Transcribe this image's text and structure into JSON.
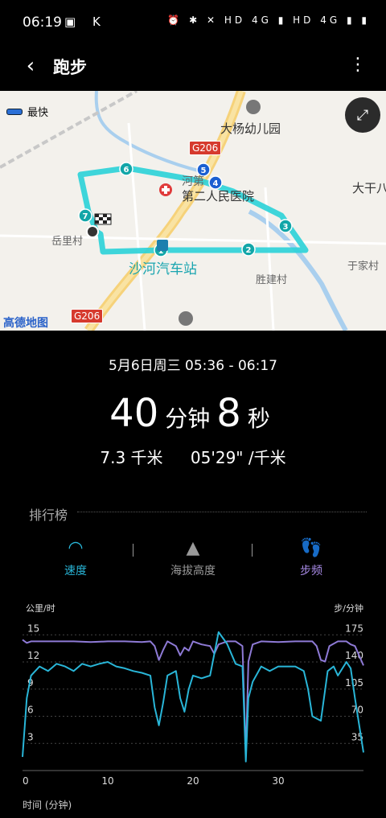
{
  "status_bar": {
    "time": "06:19",
    "left_icons": "▣ K",
    "right_icons": "⏰ ✱ ✕ HD 4G ▮ HD 4G ▮ ▮"
  },
  "app_bar": {
    "title": "跑步"
  },
  "map": {
    "legend_label": "最快",
    "labels": {
      "kindergarten": "大杨幼儿园",
      "hospital": "第二人民医院",
      "hospital_prefix": "河第",
      "dagan": "大干八",
      "yueli": "岳里村",
      "station": "沙河汽车站",
      "shengjian": "胜建村",
      "yujia": "于家村",
      "road_top": "G206",
      "road_bottom": "G206",
      "provider": "高德地图"
    },
    "markers": [
      "1",
      "2",
      "3",
      "4",
      "5",
      "6",
      "7"
    ]
  },
  "session": {
    "date_range": "5月6日周三 05:36 - 06:17",
    "minutes": "40",
    "minutes_unit": "分钟",
    "seconds": "8",
    "seconds_unit": "秒",
    "distance": "7.3 千米",
    "pace": "05'29\" /千米"
  },
  "section_title": "排行榜",
  "tabs": {
    "speed": "速度",
    "altitude": "海拔高度",
    "cadence": "步频"
  },
  "colors": {
    "speed": "#29b6d8",
    "cadence": "#8e7ad6",
    "altitude_inactive": "#999999"
  },
  "chart_data": {
    "type": "line",
    "x_label": "时间 (分钟)",
    "y_left_label": "公里/时",
    "y_right_label": "步/分钟",
    "x_ticks": [
      "0",
      "10",
      "20",
      "30"
    ],
    "y_left_ticks": [
      "15",
      "12",
      "9",
      "6",
      "3"
    ],
    "y_right_ticks": [
      "175",
      "140",
      "105",
      "70",
      "35"
    ],
    "xlim": [
      0,
      40
    ],
    "ylim_left": [
      0,
      16
    ],
    "ylim_right": [
      0,
      186
    ],
    "series": [
      {
        "name": "速度",
        "axis": "left",
        "x": [
          0,
          0.5,
          1,
          2,
          3,
          4,
          5,
          6,
          7,
          8,
          9,
          10,
          11,
          12,
          13,
          14,
          15,
          15.5,
          16,
          16.5,
          17,
          18,
          18.5,
          19,
          19.5,
          20,
          21,
          22,
          23,
          24,
          25,
          25.8,
          26.2,
          26.5,
          27,
          28,
          29,
          30,
          31,
          32,
          33,
          33.5,
          34,
          35,
          35.8,
          36.5,
          37,
          38,
          38.5,
          39,
          40
        ],
        "y": [
          1.5,
          8,
          10.5,
          11.5,
          11,
          11.8,
          11.5,
          11,
          11.8,
          11.5,
          11.8,
          12,
          11.5,
          11.3,
          11,
          10.8,
          10.5,
          7,
          5,
          7.5,
          10.5,
          11,
          8,
          6.5,
          9,
          10.5,
          10.2,
          10.5,
          15.3,
          14,
          11.8,
          11.5,
          1,
          8,
          9.8,
          11.5,
          11,
          11.5,
          11.5,
          11.5,
          11,
          9,
          6,
          5.5,
          11,
          11.5,
          10.5,
          12,
          11.3,
          8,
          2
        ]
      },
      {
        "name": "步频",
        "axis": "right",
        "x": [
          0,
          0.5,
          1,
          2,
          4,
          6,
          8,
          10,
          12,
          14,
          15,
          15.5,
          16,
          16.5,
          17,
          18,
          18.5,
          19,
          19.5,
          20,
          21,
          22,
          22.5,
          23,
          24,
          25,
          25.8,
          26.2,
          26.5,
          27,
          28,
          30,
          32,
          34,
          34.5,
          35,
          35.5,
          36,
          37,
          38,
          38.5,
          39,
          40
        ],
        "y": [
          168,
          164,
          166,
          166,
          166,
          166,
          165,
          166,
          166,
          165,
          166,
          160,
          142,
          155,
          166,
          160,
          148,
          158,
          154,
          166,
          162,
          160,
          150,
          162,
          166,
          166,
          160,
          20,
          140,
          162,
          166,
          165,
          166,
          166,
          160,
          142,
          140,
          160,
          166,
          166,
          162,
          160,
          135
        ]
      }
    ]
  }
}
